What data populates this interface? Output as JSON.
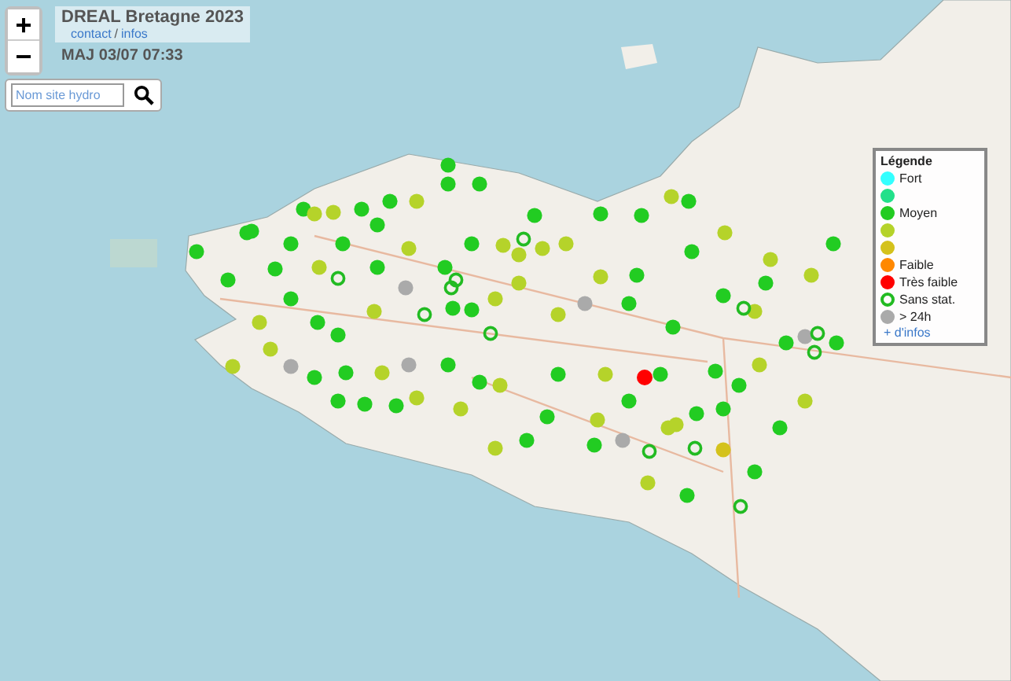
{
  "zoom_controls": [
    "+",
    "−"
  ],
  "header": {
    "title": "DREAL Bretagne 2023",
    "links": [
      "contact",
      "infos"
    ],
    "separator": "/",
    "update": "MAJ 03/07 07:33"
  },
  "search": {
    "placeholder": "Nom site hydro"
  },
  "legend": {
    "title": "Légende",
    "items": [
      {
        "label": "Fort",
        "color": "#33ffff",
        "kind": "dot"
      },
      {
        "color": "#22e08a",
        "kind": "dot"
      },
      {
        "label": "Moyen",
        "color": "#22cc22",
        "kind": "dot"
      },
      {
        "color": "#b5d32a",
        "kind": "dot"
      },
      {
        "color": "#d4c21c",
        "kind": "dot"
      },
      {
        "label": "Faible",
        "color": "#ff8800",
        "kind": "dot"
      },
      {
        "label": "Très faible",
        "color": "#ff0000",
        "kind": "dot"
      },
      {
        "label": "Sans stat.",
        "color": "#22bb22",
        "kind": "ring"
      },
      {
        "label": "> 24h",
        "color": "#aaaaaa",
        "kind": "dot"
      }
    ],
    "more_link": "+ d'infos"
  }
}
